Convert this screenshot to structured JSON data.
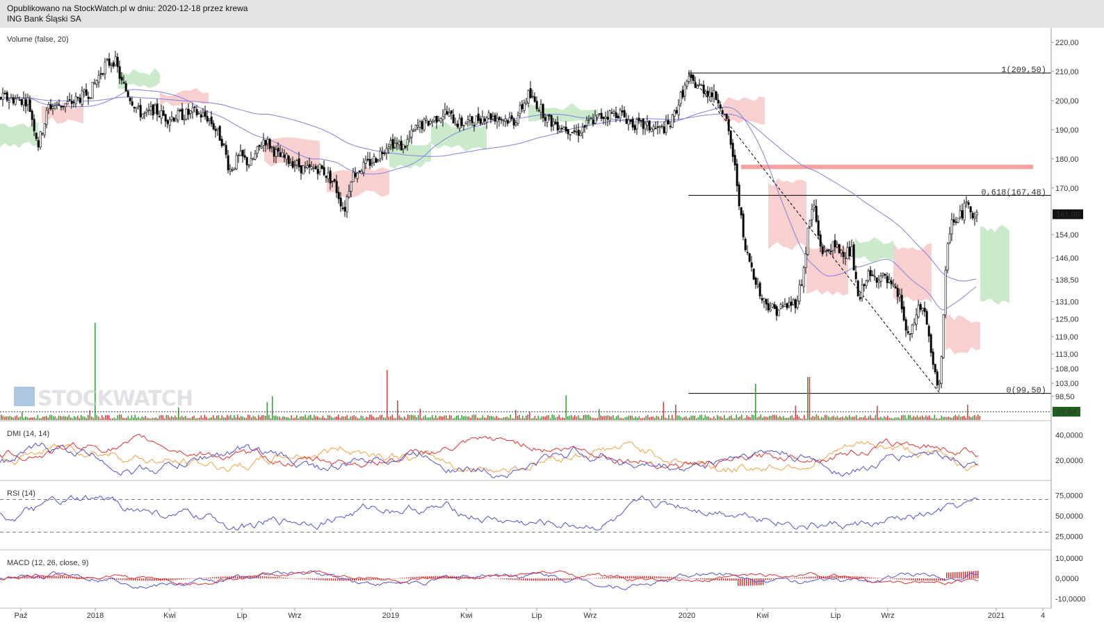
{
  "header": {
    "line1": "Opublikowano na StockWatch.pl w dniu: 2020-12-18 przez krewa",
    "line2": "ING Bank Śląski SA"
  },
  "watermark": "STOCKWATCH",
  "colors": {
    "header_bg": "#e3e3e3",
    "candle": "#000000",
    "ma_line": "#8080e0",
    "cloud_green": "#a8dca8",
    "cloud_red": "#f5b0b0",
    "zone": "#f59090",
    "vol_up": "#3aa03a",
    "vol_down": "#e04040",
    "dmi_plus": "#f0a040",
    "dmi_minus": "#e03030",
    "adx": "#5050d0",
    "rsi": "#5050d0",
    "macd": "#5050d0",
    "signal": "#e03030"
  },
  "chart_data": [
    {
      "type": "line",
      "panel": "price",
      "title": "Volume (false, 20)",
      "y_ticks": [
        "220,00",
        "210,00",
        "200,00",
        "190,00",
        "180,00",
        "170,00",
        "161,00",
        "154,00",
        "146,00",
        "138,50",
        "131,00",
        "125,00",
        "119,00",
        "113,00",
        "108,00",
        "103,00",
        "98,50"
      ],
      "y_tick_values": [
        220,
        210,
        200,
        190,
        180,
        170,
        161,
        154,
        146,
        138.5,
        131,
        125,
        119,
        113,
        108,
        103,
        98.5
      ],
      "last_price": "161,00",
      "volume_marker": "97,04",
      "x_labels": [
        "Paź",
        "2018",
        "Kwi",
        "Lip",
        "Wrz",
        "2019",
        "Kwi",
        "Lip",
        "Wrz",
        "2020",
        "Kwi",
        "Lip",
        "Wrz",
        "2021",
        "4"
      ],
      "fib_levels": [
        {
          "label": "1(209,50)",
          "value": 209.5
        },
        {
          "label": "0,618(167,48)",
          "value": 167.48
        },
        {
          "label": "0(99,50)",
          "value": 99.5
        }
      ],
      "resistance_zone": [
        176.5,
        178
      ],
      "series": [
        {
          "x": [
            0,
            40,
            55,
            70,
            100,
            130,
            150,
            165,
            175,
            190,
            200,
            210,
            220,
            240,
            260,
            280,
            300,
            320,
            330,
            345,
            360,
            380,
            400,
            420,
            440,
            460,
            480,
            495,
            505,
            520,
            540,
            560,
            580,
            600,
            620,
            640,
            660,
            680,
            700,
            720,
            740,
            760,
            775,
            790,
            810,
            830,
            850,
            870,
            890,
            910,
            930,
            950,
            965,
            980,
            990,
            1005,
            1020,
            1035,
            1045,
            1055,
            1062,
            1070,
            1078,
            1085,
            1095,
            1105,
            1115,
            1125,
            1135,
            1145,
            1155,
            1162,
            1170,
            1178,
            1185,
            1195,
            1205,
            1215,
            1225,
            1235,
            1245,
            1255,
            1265,
            1275,
            1285,
            1295,
            1305,
            1312,
            1320,
            1330,
            1338,
            1345,
            1350,
            1355,
            1360,
            1365,
            1370,
            1375,
            1385,
            1393,
            1400,
            1407
          ],
          "values": [
            201,
            200,
            185,
            198,
            199,
            203,
            212,
            214,
            206,
            200,
            196,
            195,
            197,
            194,
            195,
            196,
            194,
            186,
            176,
            181,
            178,
            187,
            181,
            179,
            176,
            177,
            172,
            162,
            174,
            177,
            180,
            186,
            184,
            191,
            193,
            196,
            192,
            193,
            195,
            194,
            193,
            202,
            198,
            193,
            191,
            189,
            193,
            195,
            196,
            192,
            191,
            190,
            192,
            202,
            207,
            205,
            203,
            200,
            192,
            180,
            168,
            150,
            145,
            140,
            132,
            130,
            128,
            129,
            130,
            131,
            140,
            155,
            165,
            152,
            147,
            150,
            149,
            148,
            148,
            130,
            140,
            139,
            140,
            138,
            135,
            132,
            118,
            121,
            129,
            128,
            114,
            105,
            102,
            115,
            140,
            155,
            160,
            158,
            162,
            166,
            160,
            161
          ]
        }
      ]
    },
    {
      "type": "line",
      "panel": "dmi",
      "title": "DMI (14, 14)",
      "y_ticks": [
        "40,0000",
        "20,0000"
      ],
      "y_tick_values": [
        40,
        20
      ]
    },
    {
      "type": "line",
      "panel": "rsi",
      "title": "RSI (14)",
      "y_ticks": [
        "75,0000",
        "50,0000",
        "25,0000"
      ],
      "y_tick_values": [
        75,
        50,
        25
      ]
    },
    {
      "type": "line",
      "panel": "macd",
      "title": "MACD (12, 26, close, 9)",
      "y_ticks": [
        "10,0000",
        "0,0000",
        "-10,0000"
      ],
      "y_tick_values": [
        10,
        0,
        -10
      ]
    }
  ]
}
